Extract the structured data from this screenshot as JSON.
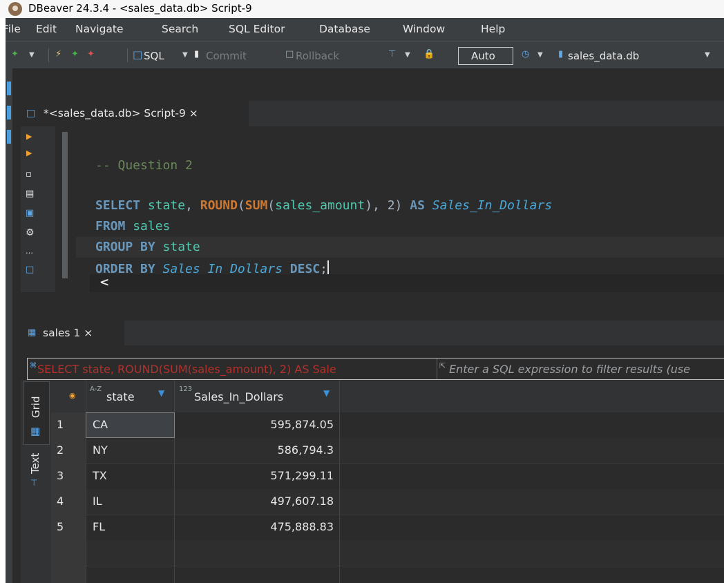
{
  "window": {
    "title": "DBeaver 24.3.4 - <sales_data.db> Script-9"
  },
  "menu": [
    "File",
    "Edit",
    "Navigate",
    "Search",
    "SQL Editor",
    "Database",
    "Window",
    "Help"
  ],
  "toolbar": {
    "sql_label": "SQL",
    "commit_label": "Commit",
    "rollback_label": "Rollback",
    "transaction_mode": "Auto",
    "datasource": "sales_data.db"
  },
  "editor_tab": {
    "label": "*<sales_data.db> Script-9",
    "close": "×"
  },
  "sql": {
    "comment": "-- Question 2",
    "line1": {
      "select": "SELECT",
      "state": "state",
      "round": "ROUND",
      "sum": "SUM",
      "col": "sales_amount",
      "two": "2",
      "as": "AS",
      "alias": "Sales_In_Dollars"
    },
    "line2": {
      "from": "FROM",
      "table": "sales"
    },
    "line3": {
      "group_by": "GROUP BY",
      "state": "state"
    },
    "line4": {
      "order_by": "ORDER BY",
      "alias": "Sales_In_Dollars",
      "desc": "DESC"
    }
  },
  "results_tab": {
    "label": "sales 1",
    "close": "×"
  },
  "filter": {
    "query": "SELECT state, ROUND(SUM(sales_amount), 2) AS Sale",
    "hint": "Enter a SQL expression to filter results (use"
  },
  "side_tabs": {
    "grid": "Grid",
    "text": "Text"
  },
  "grid": {
    "columns": [
      {
        "type": "A-Z",
        "name": "state"
      },
      {
        "type": "123",
        "name": "Sales_In_Dollars"
      }
    ],
    "rows": [
      {
        "num": "1",
        "state": "CA",
        "sales": "595,874.05"
      },
      {
        "num": "2",
        "state": "NY",
        "sales": "586,794.3"
      },
      {
        "num": "3",
        "state": "TX",
        "sales": "571,299.11"
      },
      {
        "num": "4",
        "state": "IL",
        "sales": "497,607.18"
      },
      {
        "num": "5",
        "state": "FL",
        "sales": "475,888.83"
      }
    ]
  },
  "colors": {
    "background": "#2b2b2b",
    "keyword": "#cc7832",
    "identifier": "#4ec9b0",
    "comment": "#6a8759",
    "filter_text": "#b3312b"
  }
}
